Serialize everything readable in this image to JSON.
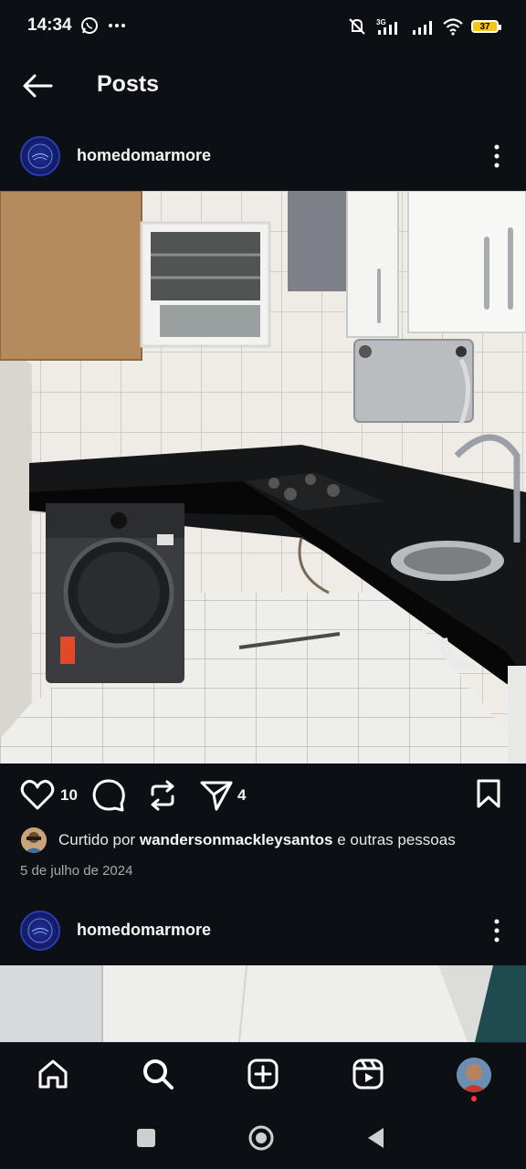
{
  "status_bar": {
    "time": "14:34",
    "left_icons": [
      "whatsapp-icon",
      "more-dots-icon"
    ],
    "network": "3G",
    "battery": "37"
  },
  "header": {
    "title": "Posts"
  },
  "post1": {
    "username": "homedomarmore",
    "likes": "10",
    "shares": "4",
    "liked_prefix": "Curtido por",
    "liked_user": "wandersonmackleysantos",
    "liked_suffix": "e outras pessoas",
    "date": "5 de julho de 2024"
  },
  "post2": {
    "username": "homedomarmore"
  },
  "bottom_nav": {
    "items": [
      "home-icon",
      "search-icon",
      "create-icon",
      "reels-icon",
      "profile-avatar"
    ],
    "active": "search-icon"
  },
  "colors": {
    "background": "#0c1014",
    "text": "#f5f5f5",
    "notification_dot": "#ff3040"
  }
}
